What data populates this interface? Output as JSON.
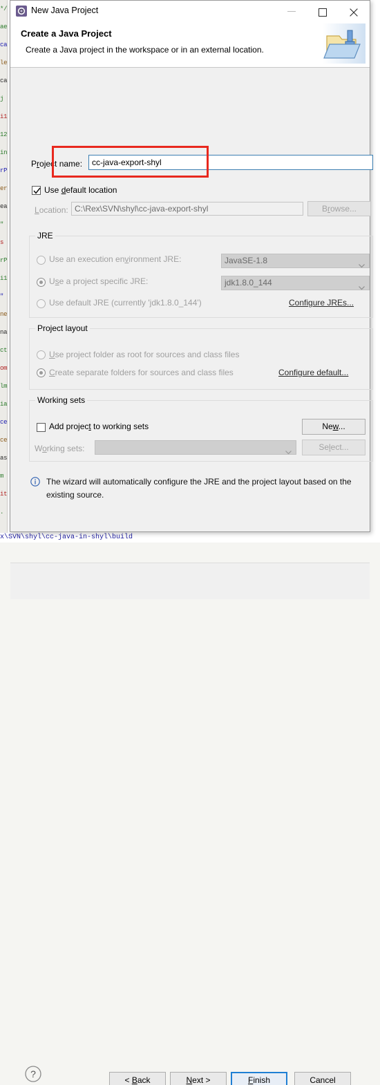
{
  "window": {
    "title": "New Java Project",
    "icon": "java-project-icon",
    "minimize_label": "Minimize",
    "maximize_label": "Maximize",
    "close_label": "Close"
  },
  "header": {
    "title": "Create a Java Project",
    "description": "Create a Java project in the workspace or in an external location.",
    "banner_icon": "folder-wizard-banner-icon"
  },
  "project_name": {
    "label": "Project name:",
    "value": "cc-java-export-shyl",
    "placeholder": "",
    "highlight_color": "#e8281e"
  },
  "location": {
    "use_default_label": "Use default location",
    "use_default_checked": true,
    "label": "Location:",
    "value": "C:\\Rex\\SVN\\shyl\\cc-java-export-shyl",
    "browse_label": "Browse...",
    "browse_enabled": false
  },
  "jre": {
    "group_title": "JRE",
    "options": [
      {
        "label": "Use an execution environment JRE:",
        "selected": false,
        "combo": "JavaSE-1.8"
      },
      {
        "label": "Use a project specific JRE:",
        "selected": true,
        "combo": "jdk1.8.0_144"
      },
      {
        "label": "Use default JRE (currently 'jdk1.8.0_144')",
        "selected": false,
        "combo": ""
      }
    ],
    "configure_link": "Configure JREs..."
  },
  "project_layout": {
    "group_title": "Project layout",
    "options": [
      {
        "label": "Use project folder as root for sources and class files",
        "selected": false
      },
      {
        "label": "Create separate folders for sources and class files",
        "selected": true
      }
    ],
    "configure_link": "Configure default..."
  },
  "working_sets": {
    "group_title": "Working sets",
    "add_label": "Add project to working sets",
    "add_checked": false,
    "new_label": "New...",
    "sets_label": "Working sets:",
    "sets_value": "",
    "select_label": "Select...",
    "select_enabled": false
  },
  "info": {
    "icon": "info-icon",
    "text": "The wizard will automatically configure the JRE and the project layout based on the existing source."
  },
  "footer": {
    "help_label": "?",
    "back_label": "< Back",
    "next_label": "Next >",
    "finish_label": "Finish",
    "cancel_label": "Cancel",
    "default_button": "Finish"
  },
  "background": {
    "status_path": "x\\SVN\\shyl\\cc-java-in-shyl\\build",
    "code_fragments": [
      "*/",
      "ae",
      "ca",
      "le",
      "ca",
      "j",
      "i1",
      "12",
      "in",
      "rP",
      "er",
      "ea",
      "\"",
      "s",
      "rP",
      "i1",
      "\"",
      "ne",
      "na",
      "ct",
      "om",
      "lm",
      "ia",
      "ce",
      "ce",
      "as",
      "m",
      "it",
      "."
    ]
  }
}
